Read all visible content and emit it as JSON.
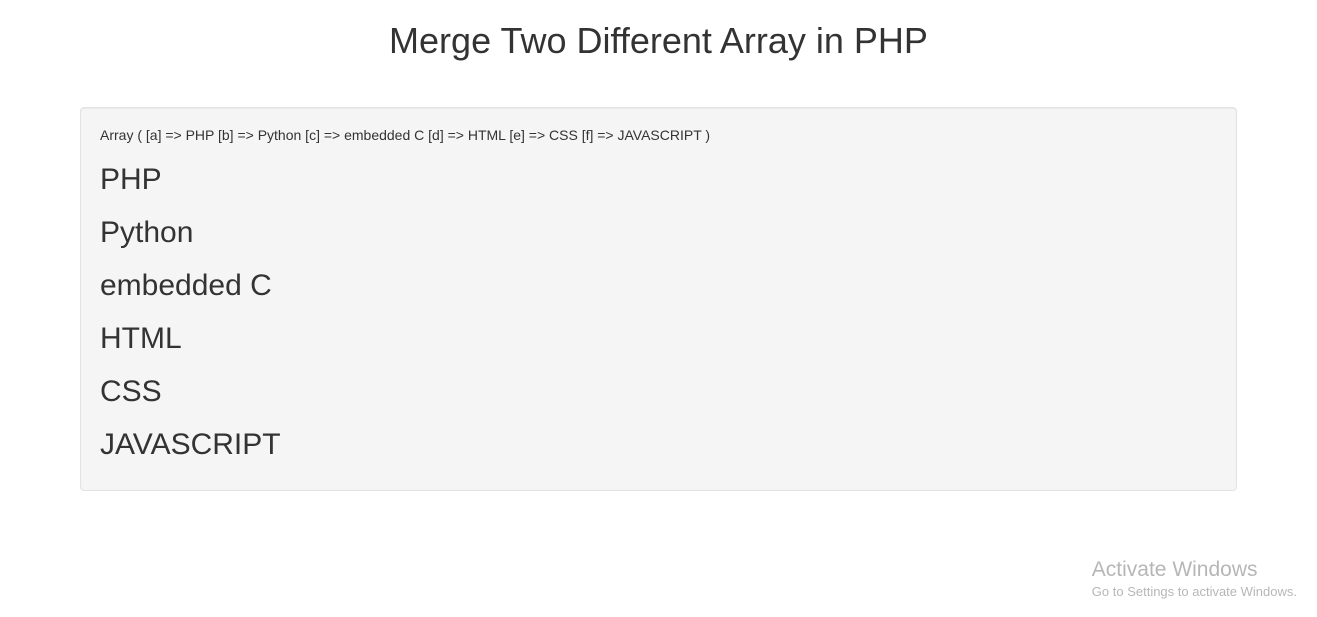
{
  "header": {
    "title": "Merge Two Different Array in PHP"
  },
  "output": {
    "array_print": "Array ( [a] => PHP [b] => Python [c] => embedded C [d] => HTML [e] => CSS [f] => JAVASCRIPT )",
    "items": [
      "PHP",
      "Python",
      "embedded C",
      "HTML",
      "CSS",
      "JAVASCRIPT"
    ]
  },
  "watermark": {
    "title": "Activate Windows",
    "subtitle": "Go to Settings to activate Windows."
  }
}
